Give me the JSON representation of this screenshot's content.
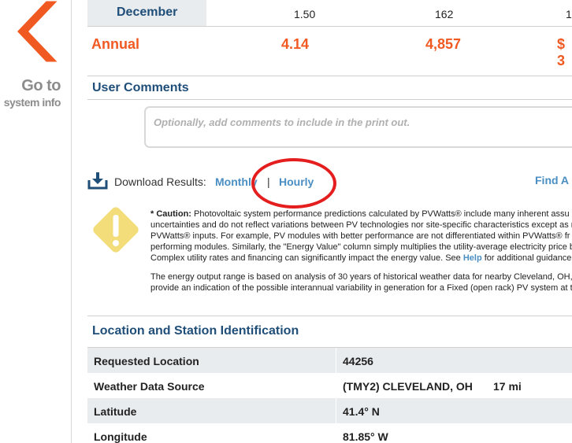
{
  "sidebar": {
    "go_to_line1": "Go to",
    "go_to_line2": "system info",
    "chevron_color": "#f05a22"
  },
  "results": {
    "december": {
      "label": "December",
      "solar_radiation": "1.50",
      "ac_energy": "162",
      "energy_value": "1"
    },
    "annual": {
      "label": "Annual",
      "solar_radiation": "4.14",
      "ac_energy": "4,857",
      "energy_value": "$ 3"
    }
  },
  "comments": {
    "title": "User Comments",
    "placeholder": "Optionally, add comments to include in the print out."
  },
  "download": {
    "label": "Download Results:",
    "monthly": "Monthly",
    "separator": "|",
    "hourly": "Hourly",
    "find": "Find A"
  },
  "caution": {
    "lead": "Caution:",
    "asterisk": "*",
    "p1_line1": "Photovoltaic system performance predictions calculated by PVWatts® include many inherent assu",
    "p1_line2": "uncertainties and do not reflect variations between PV technologies nor site-specific characteristics except as r",
    "p1_line3": "PVWatts® inputs. For example, PV modules with better performance are not differentiated within PVWatts® fr",
    "p1_line4": "performing modules. Similarly, the \"Energy Value\" column simply multiplies the utility-average electricity price b",
    "p1_line5_before": "Complex utility rates and financing can significantly impact the energy value. See",
    "p1_help": "Help",
    "p1_line5_after": "for additional guidance",
    "p2_line1": "The energy output range is based on analysis of 30 years of historical weather data for nearby Cleveland, OH,",
    "p2_line2": "provide an indication of the possible interannual variability in generation for a Fixed (open rack) PV system at t"
  },
  "location": {
    "title": "Location and Station Identification",
    "rows": [
      {
        "label": "Requested Location",
        "value": "44256",
        "extra": ""
      },
      {
        "label": "Weather Data Source",
        "value": "(TMY2) CLEVELAND, OH",
        "extra": "17 mi"
      },
      {
        "label": "Latitude",
        "value": "41.4° N",
        "extra": ""
      },
      {
        "label": "Longitude",
        "value": "81.85° W",
        "extra": ""
      }
    ]
  },
  "colors": {
    "accent_orange": "#f05a22",
    "heading_blue": "#1f4e79",
    "link_blue": "#4a8ec2",
    "annotation_red": "#e41e1e",
    "warning_yellow": "#f3dc7a"
  }
}
